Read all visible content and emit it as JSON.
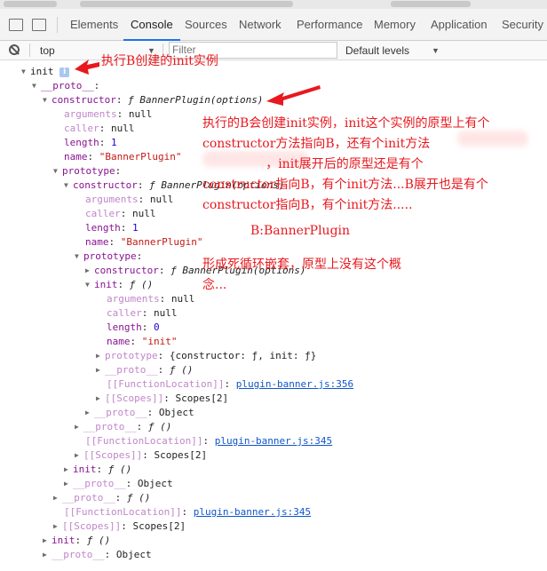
{
  "tabs": {
    "items": [
      "Elements",
      "Console",
      "Sources",
      "Network",
      "Performance",
      "Memory",
      "Application",
      "Security"
    ],
    "active": "Console"
  },
  "toolbar": {
    "context": "top",
    "filter_placeholder": "Filter",
    "levels": "Default levels"
  },
  "tree": {
    "l0": "init",
    "l1_key": "__proto__",
    "l2_key": "constructor",
    "l2_val": "BannerPlugin(options)",
    "l3_args": "null",
    "l3_caller": "null",
    "l3_length": "1",
    "l3_name": "\"BannerPlugin\"",
    "l3_proto": "prototype",
    "l4_key": "constructor",
    "l4_val": "BannerPlugin(options)",
    "l5_args": "null",
    "l5_caller": "null",
    "l5_length": "1",
    "l5_name": "\"BannerPlugin\"",
    "l5_proto": "prototype",
    "l6_key": "constructor",
    "l6_val": "BannerPlugin(options)",
    "l7_key": "init",
    "l7_val": "()",
    "l8_args": "null",
    "l8_caller": "null",
    "l8_length": "0",
    "l8_name": "\"init\"",
    "l9_proto_val": "{constructor: ƒ, init: ƒ}",
    "l9_dproto_val": "()",
    "l10_loc": "plugin-banner.js:356",
    "l10_scopes": "Scopes[2]",
    "l11_dproto": "Object",
    "l12_dproto_val": "()",
    "l12_loc": "plugin-banner.js:345",
    "l12_scopes": "Scopes[2]",
    "l13_init": "()",
    "l13_dproto": "Object",
    "l14_dproto_val": "()",
    "l14_loc": "plugin-banner.js:345",
    "l14_scopes": "Scopes[2]",
    "l15_init": "()",
    "l15_dproto": "Object"
  },
  "annotations": {
    "note1": "执行B创建的init实例",
    "note2": "执行的B会创建init实例，init这个实例的原型上有个\nconstructor方法指向B，还有个init方法\n                ，init展开后的原型还是有个\nconstructor指向B，有个init方法...B展开也是有个\nconstructor指向B，有个init方法.....",
    "note3": "B:BannerPlugin",
    "note4": "形成死循环嵌套，原型上没有这个概\n念..."
  },
  "colors": {
    "annotation": "#e8181e",
    "property_key": "#881391",
    "number": "#1c00cf",
    "string": "#c41a16",
    "link": "#1155cc",
    "active_tab_underline": "#1a73e8"
  }
}
